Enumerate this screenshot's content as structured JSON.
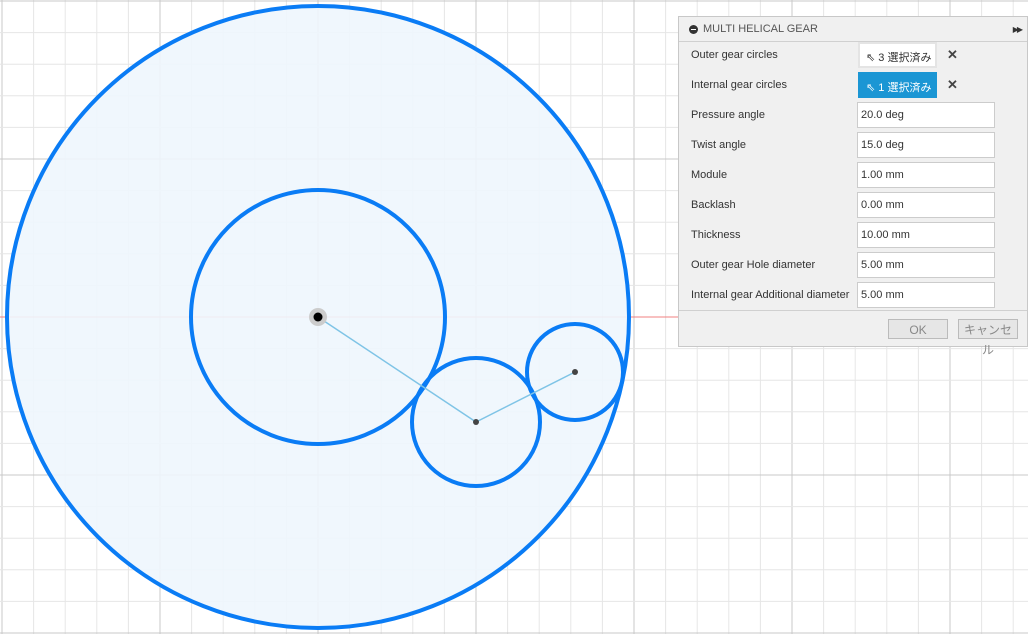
{
  "dialog": {
    "title": "MULTI HELICAL GEAR",
    "rows": [
      {
        "label": "Outer gear circles",
        "selection": "3 選択済み",
        "active": false
      },
      {
        "label": "Internal gear circles",
        "selection": "1 選択済み",
        "active": true
      },
      {
        "label": "Pressure angle",
        "value": "20.0 deg"
      },
      {
        "label": "Twist angle",
        "value": "15.0 deg"
      },
      {
        "label": "Module",
        "value": "1.00 mm"
      },
      {
        "label": "Backlash",
        "value": "0.00 mm"
      },
      {
        "label": "Thickness",
        "value": "10.00 mm"
      },
      {
        "label": "Outer gear Hole diameter",
        "value": "5.00 mm"
      },
      {
        "label": "Internal gear Additional diameter",
        "value": "5.00 mm"
      }
    ],
    "ok_label": "OK",
    "cancel_label": "キャンセル"
  },
  "colors": {
    "circle": "#0a7cf5",
    "fill": "#eef6fd",
    "link": "#7fc4e6",
    "axis": "#f08080",
    "accent": "#1b96d4"
  }
}
